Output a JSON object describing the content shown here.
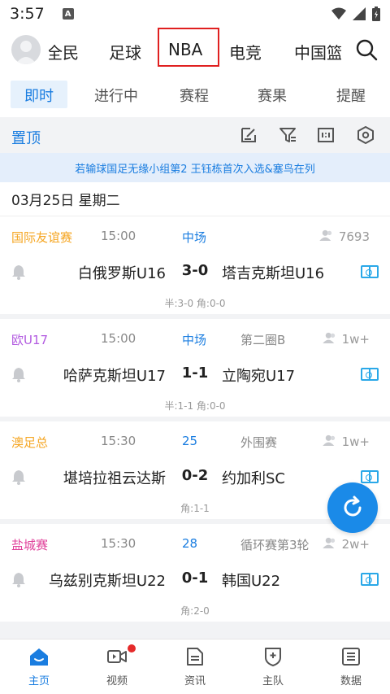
{
  "status_bar": {
    "time": "3:57",
    "notif_letter": "A"
  },
  "top_nav": {
    "items": [
      "全民",
      "足球",
      "NBA",
      "电竞",
      "中国篮"
    ]
  },
  "sub_tabs": [
    "即时",
    "进行中",
    "赛程",
    "赛果",
    "提醒"
  ],
  "toolbar": {
    "pin_label": "置顶"
  },
  "notice": "若输球国足无缘小组第2 王钰栋首次入选&塞鸟在列",
  "date_label": "03月25日 星期二",
  "matches": [
    {
      "league": "国际友谊赛",
      "league_color": "#f5a623",
      "time": "15:00",
      "status": "中场",
      "round": "",
      "count": "7693",
      "home": "白俄罗斯U16",
      "score": "3-0",
      "away": "塔吉克斯坦U16",
      "detail": "半:3-0 角:0-0"
    },
    {
      "league": "欧U17",
      "league_color": "#b25ae0",
      "time": "15:00",
      "status": "中场",
      "round": "第二圈B",
      "count": "1w+",
      "home": "哈萨克斯坦U17",
      "score": "1-1",
      "away": "立陶宛U17",
      "detail": "半:1-1 角:0-0"
    },
    {
      "league": "澳足总",
      "league_color": "#f5a623",
      "time": "15:30",
      "status": "25",
      "round": "外围赛",
      "count": "1w+",
      "home": "堪培拉祖云达斯",
      "score": "0-2",
      "away": "约加利SC",
      "detail": "角:1-1"
    },
    {
      "league": "盐城赛",
      "league_color": "#e0409a",
      "time": "15:30",
      "status": "28",
      "round": "循环赛第3轮",
      "count": "2w+",
      "home": "乌兹别克斯坦U22",
      "score": "0-1",
      "away": "韩国U22",
      "detail": "角:2-0"
    }
  ],
  "bottom_nav": [
    "主页",
    "视频",
    "资讯",
    "主队",
    "数据"
  ],
  "colors": {
    "accent": "#1a7de0",
    "highlight_box": "#e02020",
    "badge": "#e52a2a"
  }
}
